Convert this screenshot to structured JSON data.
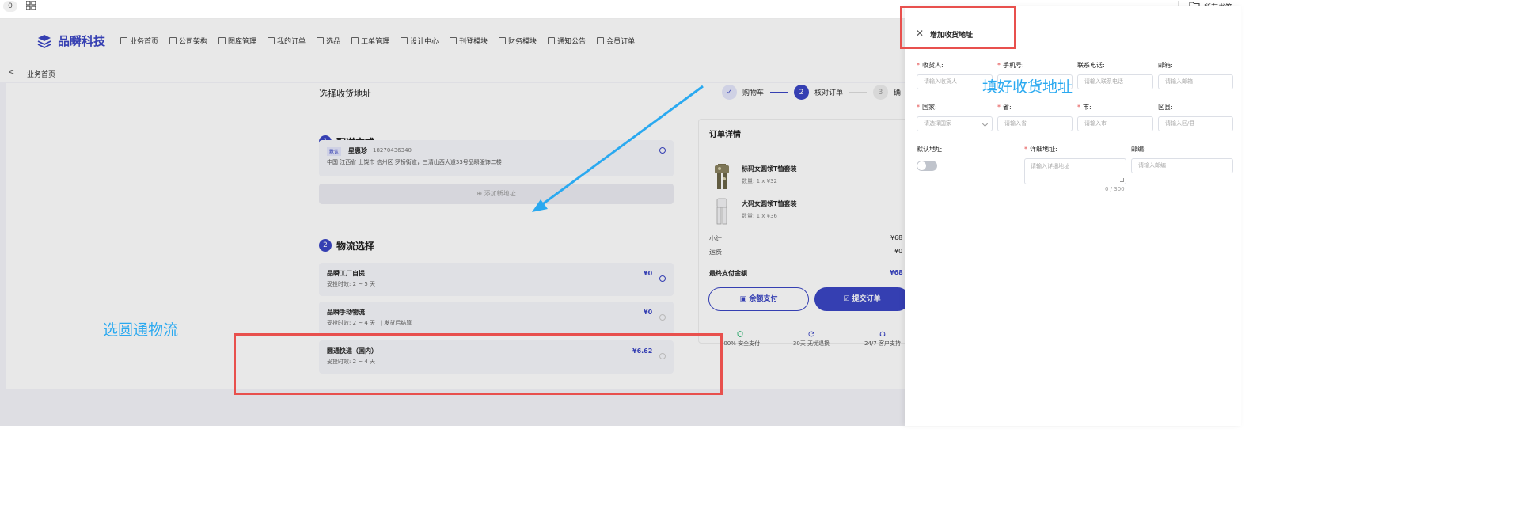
{
  "browser": {
    "tab_count": "0",
    "bookmarks_label": "所有书签"
  },
  "app": {
    "brand": "品瞬科技",
    "menu": [
      "业务首页",
      "公司架构",
      "图库管理",
      "我的订单",
      "选品",
      "工单管理",
      "设计中心",
      "刊登模块",
      "财务模块",
      "通知公告",
      "会员订单"
    ],
    "breadcrumb": "业务首页"
  },
  "checkout": {
    "select_address_title": "选择收货地址",
    "steps": [
      {
        "num": "✓",
        "label": "购物车"
      },
      {
        "num": "2",
        "label": "核对订单"
      },
      {
        "num": "3",
        "label": "确"
      }
    ],
    "delivery": {
      "num": "1",
      "title": "配送方式",
      "address": {
        "default_badge": "默认",
        "name": "星惠珍",
        "phone": "18270436340",
        "line": "中国 江西省 上饶市 信州区 罗桥街道，三清山西大道33号品瞬服饰二楼"
      },
      "add_address_label": "添加新地址"
    },
    "logistics": {
      "num": "2",
      "title": "物流选择",
      "options": [
        {
          "name": "品瞬工厂自提",
          "eta": "妥投时效: 2 ~ 5 天",
          "price": "¥0",
          "note": ""
        },
        {
          "name": "品瞬手动物流",
          "eta": "妥投时效: 2 ~ 4 天",
          "price": "¥0",
          "note": "| 发货后结算"
        },
        {
          "name": "圆通快递（国内）",
          "eta": "妥投时效: 2 ~ 4 天",
          "price": "¥6.62",
          "note": ""
        }
      ]
    },
    "order": {
      "title": "订单详情",
      "products": [
        {
          "name": "标码女圆领T恤套装",
          "qty": "数量: 1 x ¥32"
        },
        {
          "name": "大码女圆领T恤套装",
          "qty": "数量: 1 x ¥36"
        }
      ],
      "subtotal_label": "小计",
      "subtotal_value": "¥68",
      "shipping_label": "运费",
      "shipping_value": "¥0",
      "total_label": "最终支付金额",
      "total_value": "¥68",
      "balance_pay_label": "余额支付",
      "submit_label": "提交订单",
      "trust": [
        "100% 安全支付",
        "30天 无忧退换",
        "24/7 客户支持"
      ]
    }
  },
  "drawer": {
    "title": "增加收货地址",
    "fields": {
      "receiver": {
        "label": "收货人:",
        "placeholder": "请输入收货人"
      },
      "mobile": {
        "label": "手机号:",
        "placeholder": ""
      },
      "phone": {
        "label": "联系电话:",
        "placeholder": "请输入联系电话"
      },
      "email": {
        "label": "邮箱:",
        "placeholder": "请输入邮箱"
      },
      "country": {
        "label": "国家:",
        "placeholder": "请选择国家"
      },
      "province": {
        "label": "省:",
        "placeholder": "请输入省"
      },
      "city": {
        "label": "市:",
        "placeholder": "请输入市"
      },
      "district": {
        "label": "区县:",
        "placeholder": "请输入区/县"
      },
      "default": {
        "label": "默认地址"
      },
      "detail": {
        "label": "详细地址:",
        "placeholder": "请输入详细地址",
        "counter": "0 / 300"
      },
      "postcode": {
        "label": "邮编:",
        "placeholder": "请输入邮编"
      }
    }
  },
  "annotations": {
    "fill_address": "填好收货地址",
    "choose_logistics": "选圆通物流",
    "color_box": "#e8504d",
    "color_text": "#2aa9f0"
  },
  "colors": {
    "primary": "#3b46c4",
    "required": "#e34b4b"
  }
}
